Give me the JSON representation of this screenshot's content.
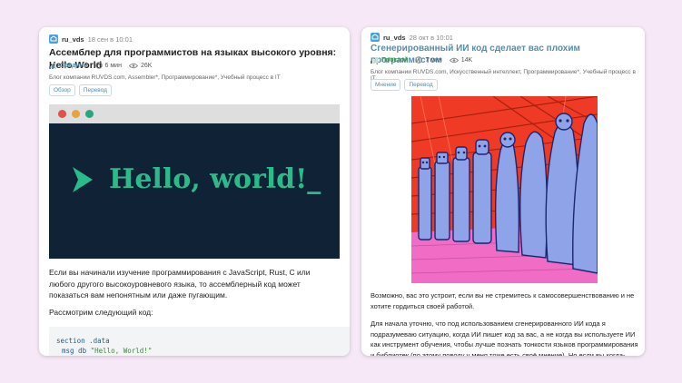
{
  "left_card": {
    "author": "ru_vds",
    "date": "18 сен в 10:01",
    "title": "Ассемблер для программистов на языках высокого уровня: Hello World",
    "level": "Средний",
    "read_time": "6 мин",
    "views": "26K",
    "hubs": "Блог компании RUVDS.com, Assembler*, Программирование*, Учебный процесс в IT",
    "tags": [
      "Обзор",
      "Перевод"
    ],
    "hero_text": "Hello, world!_",
    "paragraph1": "Если вы начинали изучение программирования с JavaScript, Rust, C или любого другого высокоуровневого языка, то ассемблерный код может показаться вам непонятным или даже пугающим.",
    "paragraph2": "Рассмотрим следующий код:",
    "code_line1": "section .data",
    "code_line2_kw": "msg db ",
    "code_line2_str": "\"Hello, World!\""
  },
  "right_card": {
    "author": "ru_vds",
    "date": "28 окт в 10:01",
    "title": "Сгенерированный ИИ код сделает вас плохим программистом",
    "level": "Простой",
    "read_time": "7 мин",
    "views": "14K",
    "hubs": "Блог компании RUVDS.com, Искусственный интеллект, Программирование*, Учебный процесс в IT",
    "tags": [
      "Мнение",
      "Перевод"
    ],
    "paragraph1": "Возможно, вас это устроит, если вы не стремитесь к самосовершенствованию и не хотите гордиться своей работой.",
    "paragraph2": "Для начала уточню, что под использованием сгенерированного ИИ кода я подразумеваю ситуацию, когда ИИ пишет код за вас, а не когда вы используете ИИ как инструмент обучения, чтобы лучше познать тонкости языков программирования и библиотек (по этому поводу у меня тоже есть своё мнение). Но если вы когда-нибудь применяли эти инструменты для того, чтобы"
  },
  "colors": {
    "background": "#f6e8f6",
    "link_blue": "#548eaa",
    "hero_dark": "#0f2236",
    "hero_green": "#2bbb8a",
    "art_red": "#ef3b25",
    "art_pink": "#f06cc5"
  }
}
